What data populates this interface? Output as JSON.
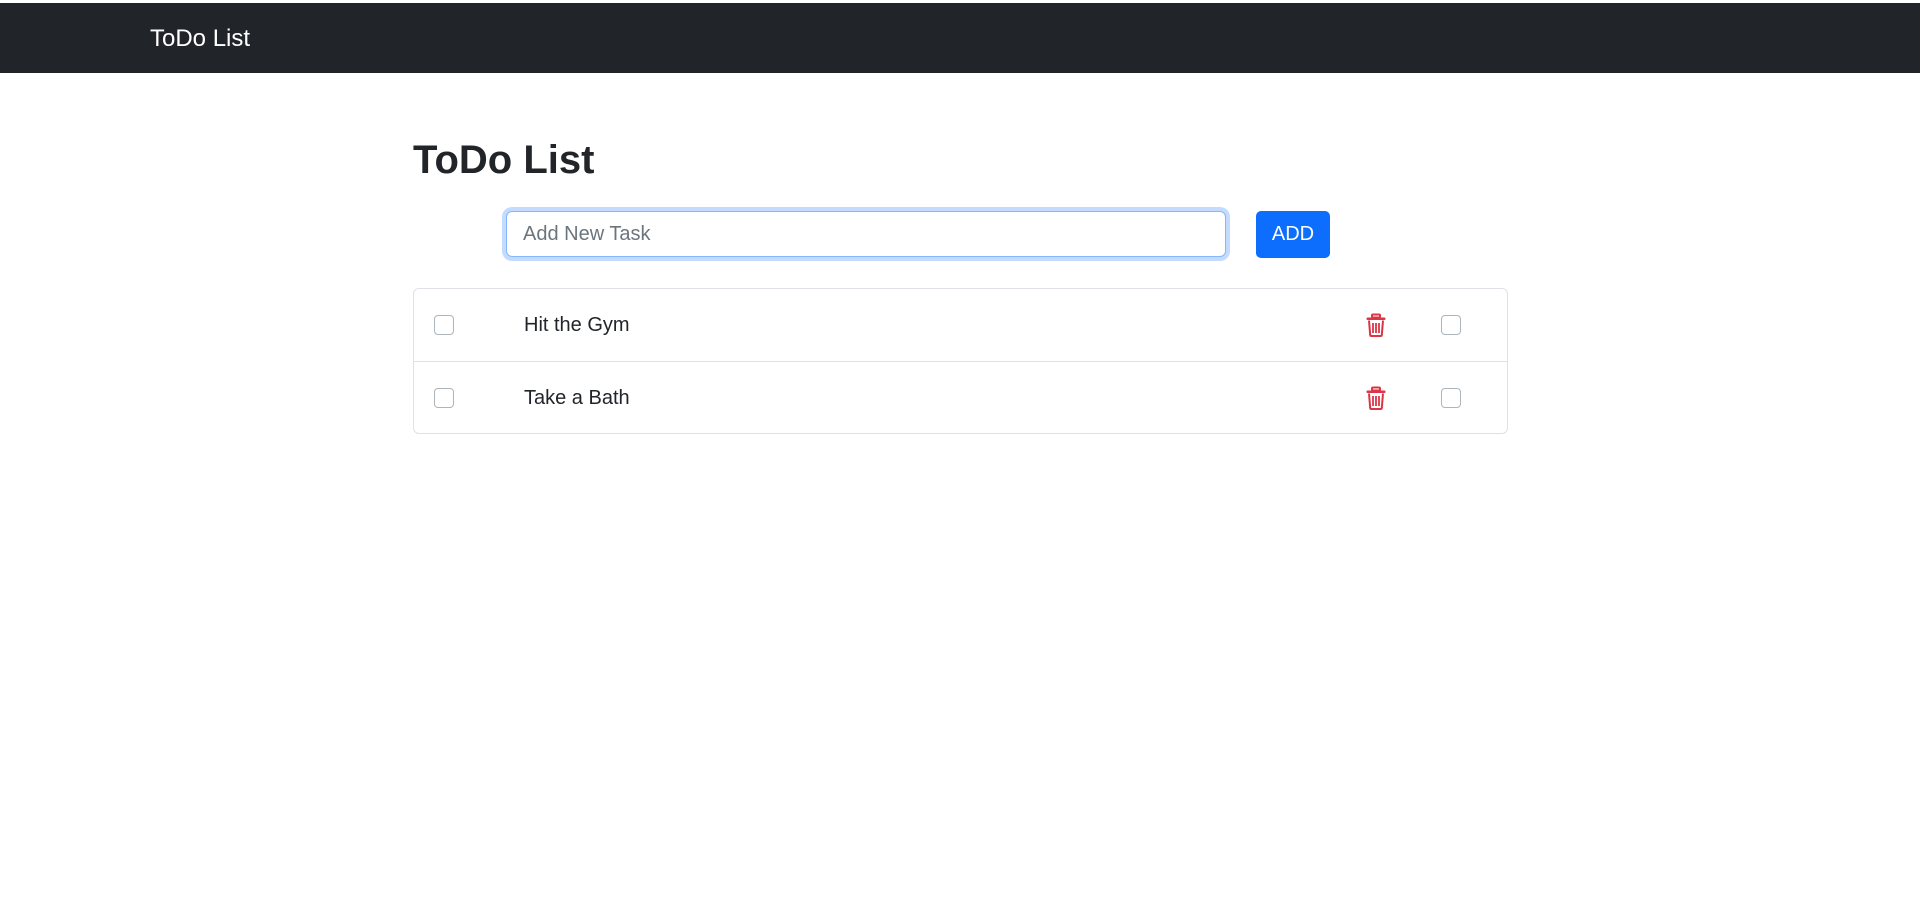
{
  "navbar": {
    "brand": "ToDo List"
  },
  "main": {
    "title": "ToDo List",
    "new_task": {
      "value": "",
      "placeholder": "Add New Task"
    },
    "add_button_label": "ADD",
    "tasks": [
      {
        "text": "Hit the Gym"
      },
      {
        "text": "Take a Bath"
      }
    ]
  },
  "icons": {
    "delete": "trash-icon"
  },
  "colors": {
    "navbar_bg": "#212529",
    "primary": "#0d6efd",
    "danger": "#dc3545",
    "border": "#dee2e6"
  }
}
